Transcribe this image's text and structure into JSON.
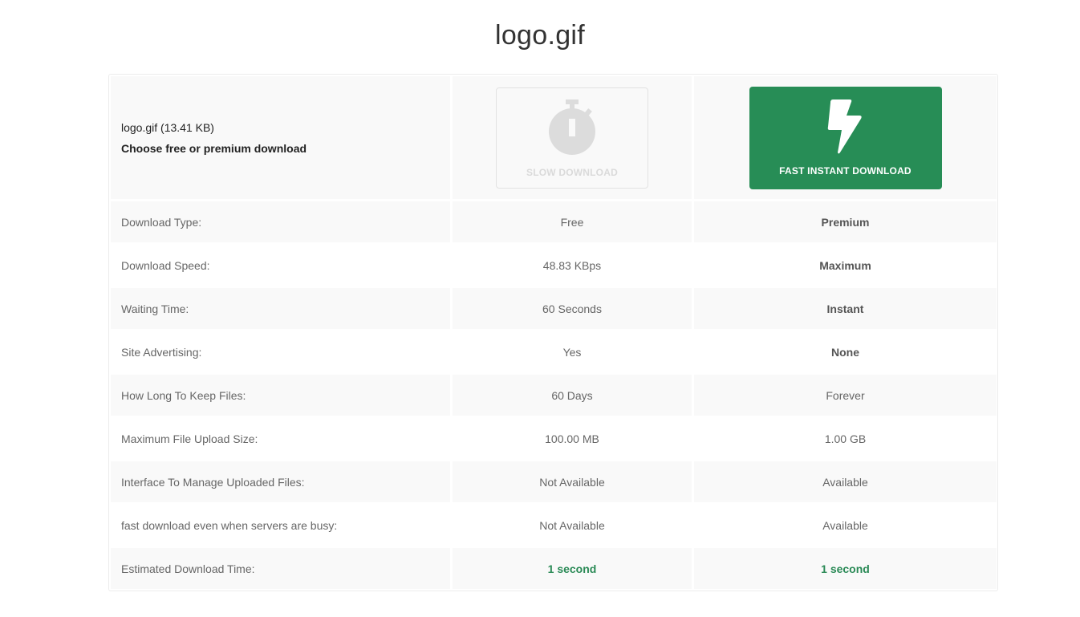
{
  "page": {
    "title": "logo.gif"
  },
  "file": {
    "name_size": "logo.gif (13.41 KB)",
    "choose_text": "Choose free or premium download"
  },
  "buttons": {
    "slow": {
      "label": "SLOW DOWNLOAD",
      "icon": "stopwatch-icon"
    },
    "fast": {
      "label": "FAST INSTANT DOWNLOAD",
      "icon": "lightning-bolt-icon"
    }
  },
  "colors": {
    "accent_green": "#278d56",
    "highlight_text_green": "#2a8a56"
  },
  "rows": [
    {
      "label": "Download Type:",
      "free": "Free",
      "premium": "Premium"
    },
    {
      "label": "Download Speed:",
      "free": "48.83 KBps",
      "premium": "Maximum"
    },
    {
      "label": "Waiting Time:",
      "free": "60 Seconds",
      "premium": "Instant"
    },
    {
      "label": "Site Advertising:",
      "free": "Yes",
      "premium": "None"
    },
    {
      "label": "How Long To Keep Files:",
      "free": "60 Days",
      "premium": "Forever"
    },
    {
      "label": "Maximum File Upload Size:",
      "free": "100.00 MB",
      "premium": "1.00 GB"
    },
    {
      "label": "Interface To Manage Uploaded Files:",
      "free": "Not Available",
      "premium": "Available"
    },
    {
      "label": "fast download even when servers are busy:",
      "free": "Not Available",
      "premium": "Available"
    },
    {
      "label": "Estimated Download Time:",
      "free": "1 second",
      "premium": "1 second"
    }
  ]
}
